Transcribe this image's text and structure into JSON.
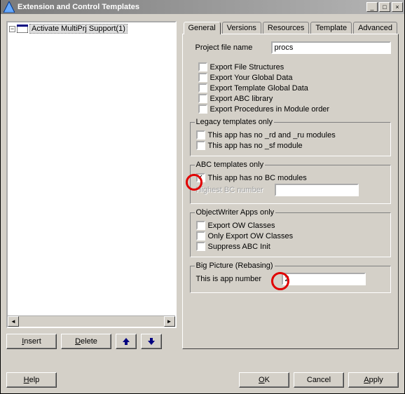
{
  "window": {
    "title": "Extension and Control Templates",
    "min_icon": "_",
    "max_icon": "□",
    "close_icon": "×"
  },
  "tree": {
    "items": [
      {
        "label": "Activate MultiPrj Support(1)"
      }
    ]
  },
  "left_buttons": {
    "insert": "Insert",
    "delete": "Delete"
  },
  "tabs": [
    {
      "label": "General",
      "active": true
    },
    {
      "label": "Versions"
    },
    {
      "label": "Resources"
    },
    {
      "label": "Template"
    },
    {
      "label": "Advanced"
    }
  ],
  "general": {
    "project_file_label": "Project file name",
    "project_file_value": "procs",
    "export_checks": [
      {
        "label": "Export File Structures",
        "checked": false
      },
      {
        "label": "Export Your Global Data",
        "checked": false
      },
      {
        "label": "Export Template Global Data",
        "checked": false
      },
      {
        "label": "Export ABC library",
        "checked": false
      },
      {
        "label": "Export Procedures in Module order",
        "checked": false
      }
    ],
    "legacy": {
      "title": "Legacy templates only",
      "checks": [
        {
          "label": "This app has no _rd and _ru modules",
          "checked": false
        },
        {
          "label": "This app has no _sf module",
          "checked": false
        }
      ]
    },
    "abc": {
      "title": "ABC templates only",
      "check": {
        "label": "This app has no BC modules",
        "checked": true
      },
      "highest_label": "Highest BC number",
      "highest_value": ""
    },
    "ow": {
      "title": "ObjectWriter Apps only",
      "checks": [
        {
          "label": "Export OW Classes",
          "checked": false
        },
        {
          "label": "Only Export OW Classes",
          "checked": false
        },
        {
          "label": "Suppress ABC Init",
          "checked": false
        }
      ]
    },
    "bigpic": {
      "title": "Big Picture (Rebasing)",
      "label": "This is app number",
      "value": "2"
    }
  },
  "footer": {
    "help": "Help",
    "ok": "OK",
    "cancel": "Cancel",
    "apply": "Apply"
  }
}
